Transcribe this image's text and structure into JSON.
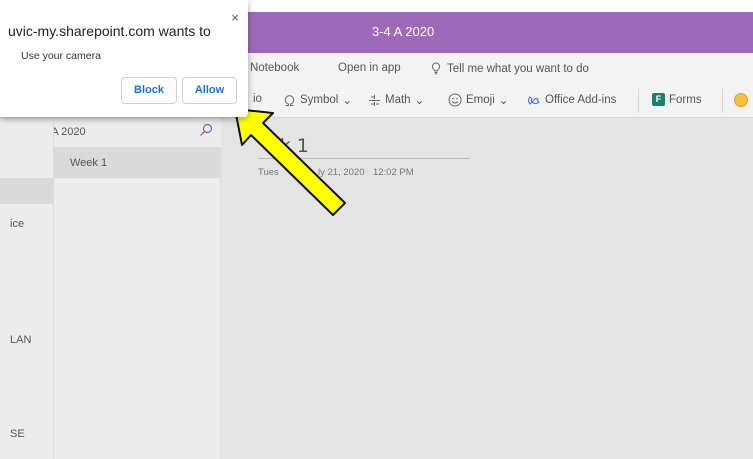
{
  "window": {
    "title": "3-4 A 2020"
  },
  "ribbon_tabs": [
    "Notebook",
    "Open in app",
    "Tell me what you want to do"
  ],
  "ribbon_items": {
    "audio_partial": "io",
    "symbol": "Symbol",
    "math": "Math",
    "emoji": "Emoji",
    "addins": "Office Add-ins",
    "forms": "Forms"
  },
  "notebook": {
    "name": "3-4 A 2020"
  },
  "sections": [
    "ice",
    "LAN",
    "SE"
  ],
  "pages": [
    {
      "label": "Week 1"
    }
  ],
  "page": {
    "title": "ek 1",
    "date_partial": "Tues",
    "date_rest": "ly 21, 2020",
    "time": "12:02 PM"
  },
  "permission_dialog": {
    "host": "uvic-my.sharepoint.com wants to",
    "message": "Use your camera",
    "block_label": "Block",
    "allow_label": "Allow",
    "close_glyph": "×"
  },
  "colors": {
    "accent": "#9f69b9",
    "link": "#1a73e8",
    "arrow": "#ffff00"
  }
}
